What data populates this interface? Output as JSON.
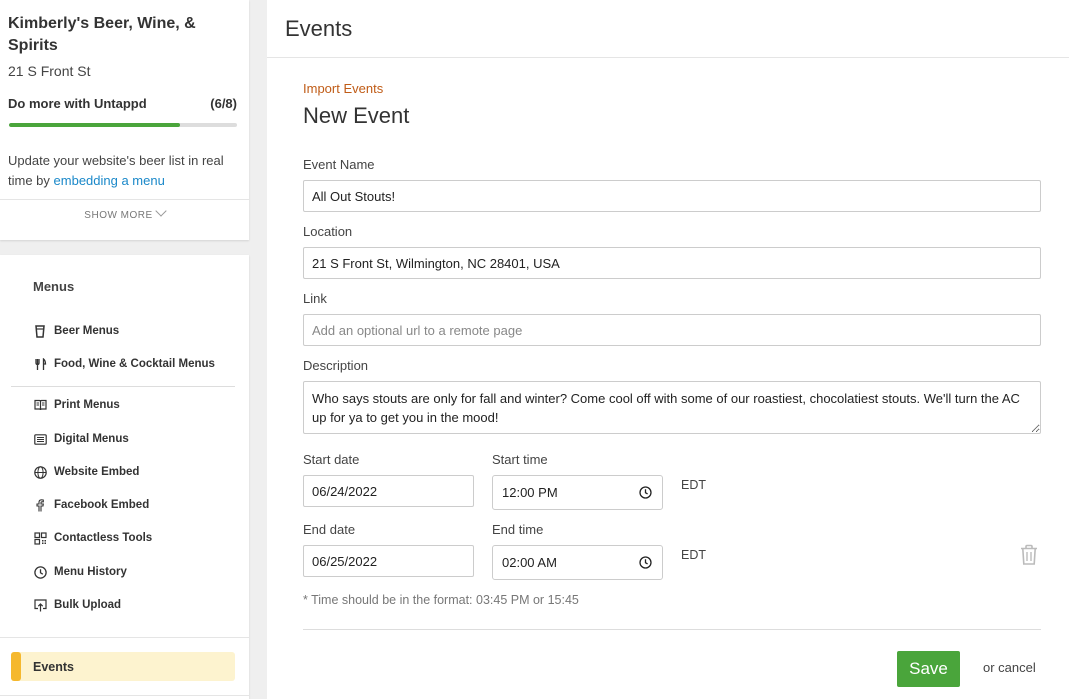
{
  "venue": {
    "name": "Kimberly's Beer, Wine, & Spirits",
    "address": "21 S Front St"
  },
  "onboarding": {
    "label": "Do more with Untappd",
    "count": "(6/8)",
    "progress_fraction": 0.75,
    "promo_prefix": "Update your website's beer list in real time by",
    "promo_link": "embedding a menu",
    "show_more": "SHOW MORE"
  },
  "nav": {
    "heading": "Menus",
    "items": [
      {
        "label": "Beer Menus",
        "icon": "beer-glass-icon"
      },
      {
        "label": "Food, Wine & Cocktail Menus",
        "icon": "fork-knife-icon"
      },
      {
        "label": "Print Menus",
        "icon": "print-menu-icon"
      },
      {
        "label": "Digital Menus",
        "icon": "digital-menu-icon"
      },
      {
        "label": "Website Embed",
        "icon": "globe-icon"
      },
      {
        "label": "Facebook Embed",
        "icon": "facebook-icon"
      },
      {
        "label": "Contactless Tools",
        "icon": "qr-code-icon"
      },
      {
        "label": "Menu History",
        "icon": "clock-icon"
      },
      {
        "label": "Bulk Upload",
        "icon": "upload-icon"
      }
    ],
    "active": "Events"
  },
  "header": {
    "title": "Events"
  },
  "form": {
    "import_link": "Import Events",
    "title": "New Event",
    "event_name_label": "Event Name",
    "event_name_value": "All Out Stouts!",
    "location_label": "Location",
    "location_value": "21 S Front St, Wilmington, NC 28401, USA",
    "link_label": "Link",
    "link_placeholder": "Add an optional url to a remote page",
    "description_label": "Description",
    "description_value": "Who says stouts are only for fall and winter? Come cool off with some of our roastiest, chocolatiest stouts. We'll turn the AC up for ya to get you in the mood!",
    "start_date_label": "Start date",
    "start_date_value": "06/24/2022",
    "start_time_label": "Start time",
    "start_time_value": "12:00 PM",
    "start_tz": "EDT",
    "end_date_label": "End date",
    "end_date_value": "06/25/2022",
    "end_time_label": "End time",
    "end_time_value": "02:00 AM",
    "end_tz": "EDT",
    "hint": "* Time should be in the format: 03:45 PM or 15:45",
    "save_label": "Save",
    "cancel_label": "or cancel"
  },
  "colors": {
    "accent_green": "#4aa53b",
    "link_blue": "#1a88c9",
    "import_orange": "#c05c17",
    "active_yellow": "#f5b82e"
  }
}
